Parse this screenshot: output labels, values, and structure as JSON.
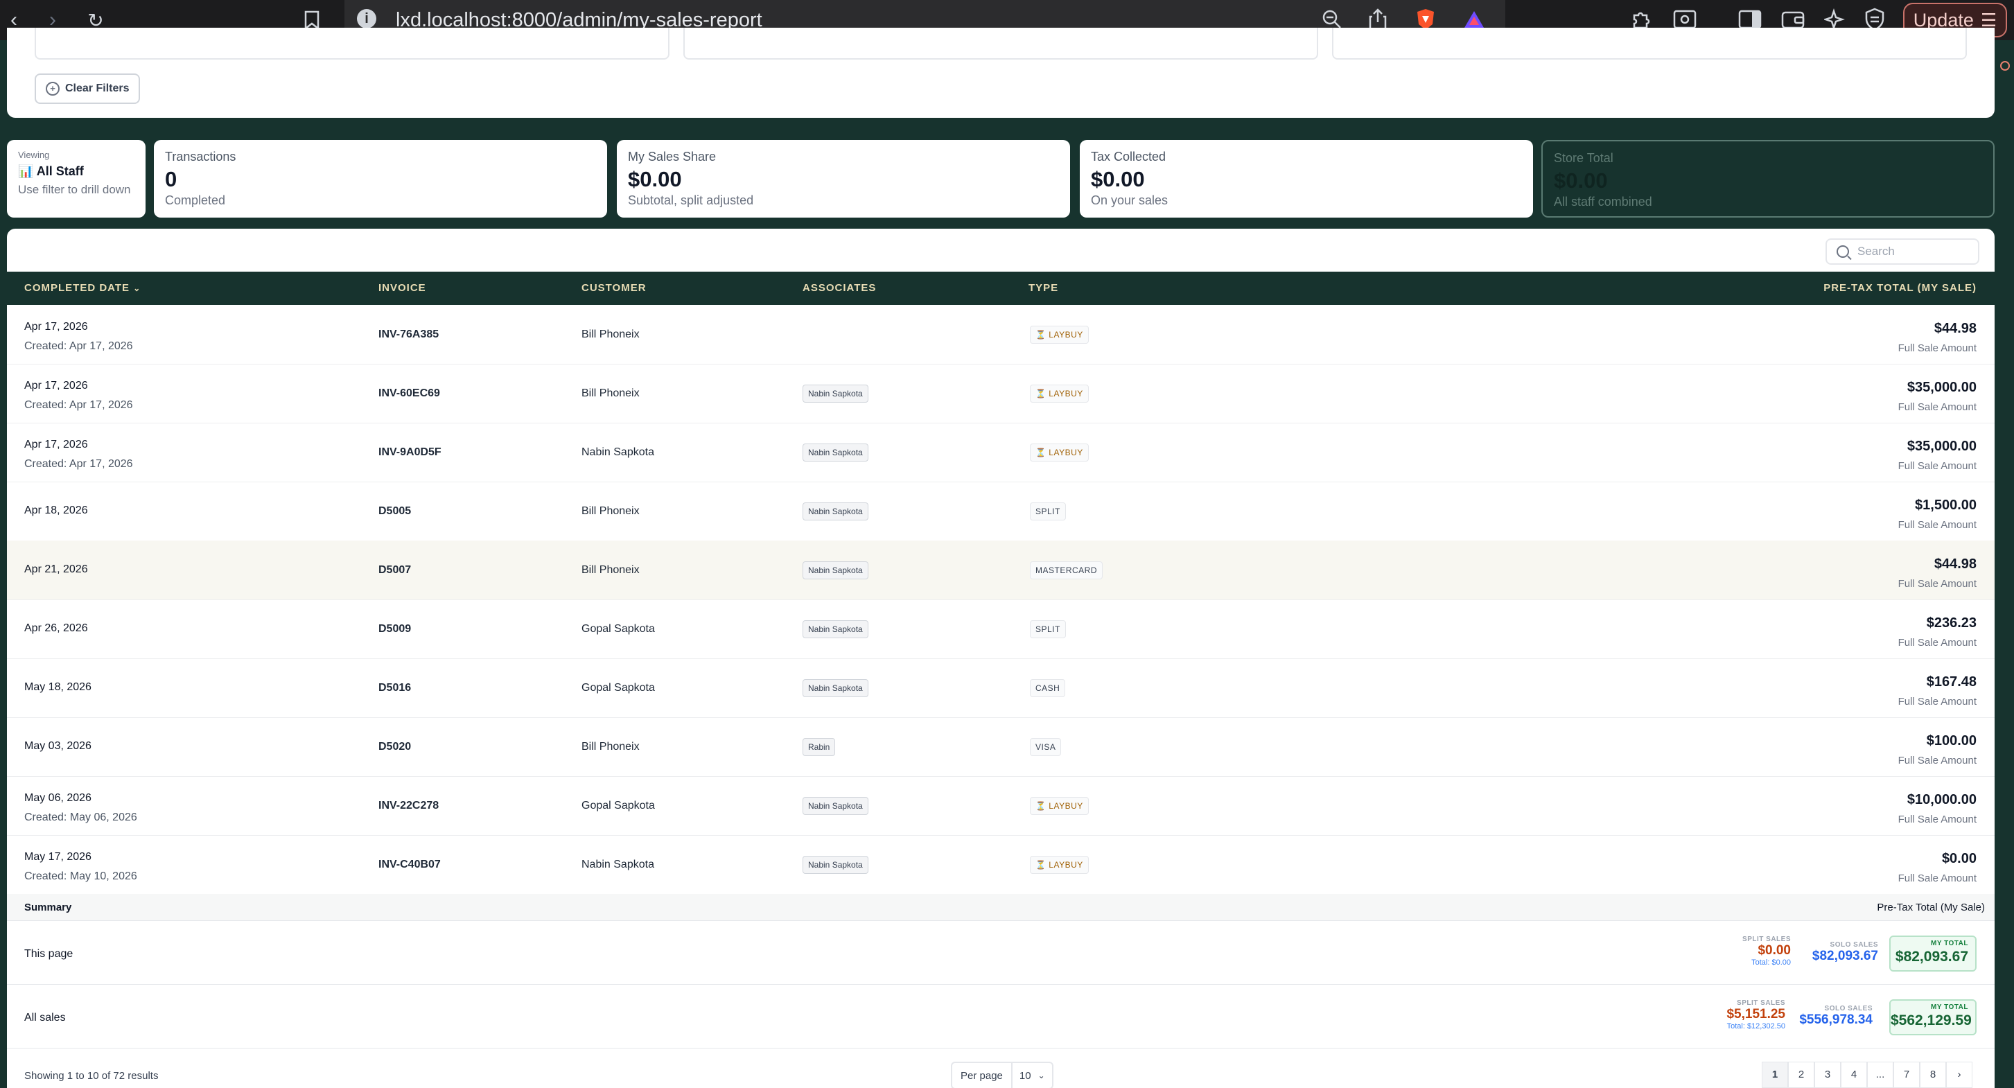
{
  "browser": {
    "url": "lxd.localhost:8000/admin/my-sales-report",
    "update_label": "Update"
  },
  "filters": {
    "clear_label": "Clear Filters"
  },
  "stats": {
    "viewing": {
      "label": "Viewing",
      "value": "📊 All Staff",
      "hint": "Use filter to drill down"
    },
    "transactions": {
      "label": "Transactions",
      "value": "0",
      "sub": "Completed"
    },
    "my_share": {
      "label": "My Sales Share",
      "value": "$0.00",
      "sub": "Subtotal, split adjusted"
    },
    "tax": {
      "label": "Tax Collected",
      "value": "$0.00",
      "sub": "On your sales"
    },
    "store_total": {
      "label": "Store Total",
      "value": "$0.00",
      "sub": "All staff combined"
    }
  },
  "search": {
    "placeholder": "Search"
  },
  "columns": {
    "date": "COMPLETED DATE",
    "invoice": "INVOICE",
    "customer": "CUSTOMER",
    "associates": "ASSOCIATES",
    "type": "TYPE",
    "total": "PRE-TAX TOTAL (MY SALE)"
  },
  "rows": [
    {
      "completed": "Apr 17, 2026",
      "created": "Created: Apr 17, 2026",
      "invoice": "INV-76A385",
      "customer": "Bill Phoneix",
      "associate": "",
      "type": "⏳ LAYBUY",
      "amount": "$44.98",
      "amount_note": "Full Sale Amount"
    },
    {
      "completed": "Apr 17, 2026",
      "created": "Created: Apr 17, 2026",
      "invoice": "INV-60EC69",
      "customer": "Bill Phoneix",
      "associate": "Nabin Sapkota",
      "type": "⏳ LAYBUY",
      "amount": "$35,000.00",
      "amount_note": "Full Sale Amount"
    },
    {
      "completed": "Apr 17, 2026",
      "created": "Created: Apr 17, 2026",
      "invoice": "INV-9A0D5F",
      "customer": "Nabin Sapkota",
      "associate": "Nabin Sapkota",
      "type": "⏳ LAYBUY",
      "amount": "$35,000.00",
      "amount_note": "Full Sale Amount"
    },
    {
      "completed": "Apr 18, 2026",
      "created": "",
      "invoice": "D5005",
      "customer": "Bill Phoneix",
      "associate": "Nabin Sapkota",
      "type": "SPLIT",
      "amount": "$1,500.00",
      "amount_note": "Full Sale Amount"
    },
    {
      "completed": "Apr 21, 2026",
      "created": "",
      "invoice": "D5007",
      "customer": "Bill Phoneix",
      "associate": "Nabin Sapkota",
      "type": "MASTERCARD",
      "amount": "$44.98",
      "amount_note": "Full Sale Amount"
    },
    {
      "completed": "Apr 26, 2026",
      "created": "",
      "invoice": "D5009",
      "customer": "Gopal Sapkota",
      "associate": "Nabin Sapkota",
      "type": "SPLIT",
      "amount": "$236.23",
      "amount_note": "Full Sale Amount"
    },
    {
      "completed": "May 18, 2026",
      "created": "",
      "invoice": "D5016",
      "customer": "Gopal Sapkota",
      "associate": "Nabin Sapkota",
      "type": "CASH",
      "amount": "$167.48",
      "amount_note": "Full Sale Amount"
    },
    {
      "completed": "May 03, 2026",
      "created": "",
      "invoice": "D5020",
      "customer": "Bill Phoneix",
      "associate": "Rabin",
      "type": "VISA",
      "amount": "$100.00",
      "amount_note": "Full Sale Amount"
    },
    {
      "completed": "May 06, 2026",
      "created": "Created: May 06, 2026",
      "invoice": "INV-22C278",
      "customer": "Gopal Sapkota",
      "associate": "Nabin Sapkota",
      "type": "⏳ LAYBUY",
      "amount": "$10,000.00",
      "amount_note": "Full Sale Amount"
    },
    {
      "completed": "May 17, 2026",
      "created": "Created: May 10, 2026",
      "invoice": "INV-C40B07",
      "customer": "Nabin Sapkota",
      "associate": "Nabin Sapkota",
      "type": "⏳ LAYBUY",
      "amount": "$0.00",
      "amount_note": "Full Sale Amount"
    }
  ],
  "summary": {
    "label": "Summary",
    "column_label": "Pre-Tax Total (My Sale)",
    "split_key": "SPLIT SALES",
    "solo_key": "SOLO SALES",
    "total_key": "MY TOTAL",
    "this_page": {
      "label": "This page",
      "split": "$0.00",
      "split_total": "Total: $0.00",
      "solo": "$82,093.67",
      "my_total": "$82,093.67"
    },
    "all_sales": {
      "label": "All sales",
      "split": "$5,151.25",
      "split_total": "Total: $12,302.50",
      "solo": "$556,978.34",
      "my_total": "$562,129.59"
    }
  },
  "footer": {
    "showing": "Showing 1 to 10 of 72 results",
    "per_page_label": "Per page",
    "per_page_value": "10",
    "pages": [
      "1",
      "2",
      "3",
      "4",
      "...",
      "7",
      "8",
      "›"
    ]
  }
}
